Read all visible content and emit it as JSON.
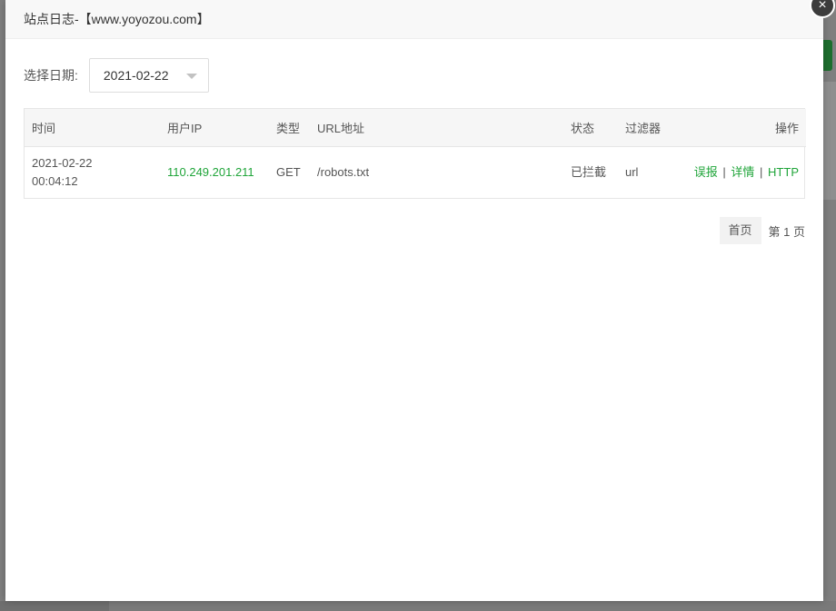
{
  "dialog": {
    "title": "站点日志-【www.yoyozou.com】",
    "close_icon": "×"
  },
  "filter": {
    "label": "选择日期:",
    "date_value": "2021-02-22"
  },
  "table": {
    "headers": {
      "time": "时间",
      "ip": "用户IP",
      "type": "类型",
      "url": "URL地址",
      "status": "状态",
      "filter": "过滤器",
      "actions": "操作"
    },
    "rows": [
      {
        "date": "2021-02-22",
        "time": "00:04:12",
        "ip": "110.249.201.211",
        "method": "GET",
        "url": "/robots.txt",
        "status": "已拦截",
        "filter": "url",
        "action_report": "误报",
        "action_detail": "详情",
        "action_http": "HTTP",
        "separator": "|"
      }
    ]
  },
  "pager": {
    "first": "首页",
    "page_info": "第 1 页"
  },
  "colors": {
    "accent_green": "#20a53a",
    "overlay": "#7f7f7f"
  }
}
